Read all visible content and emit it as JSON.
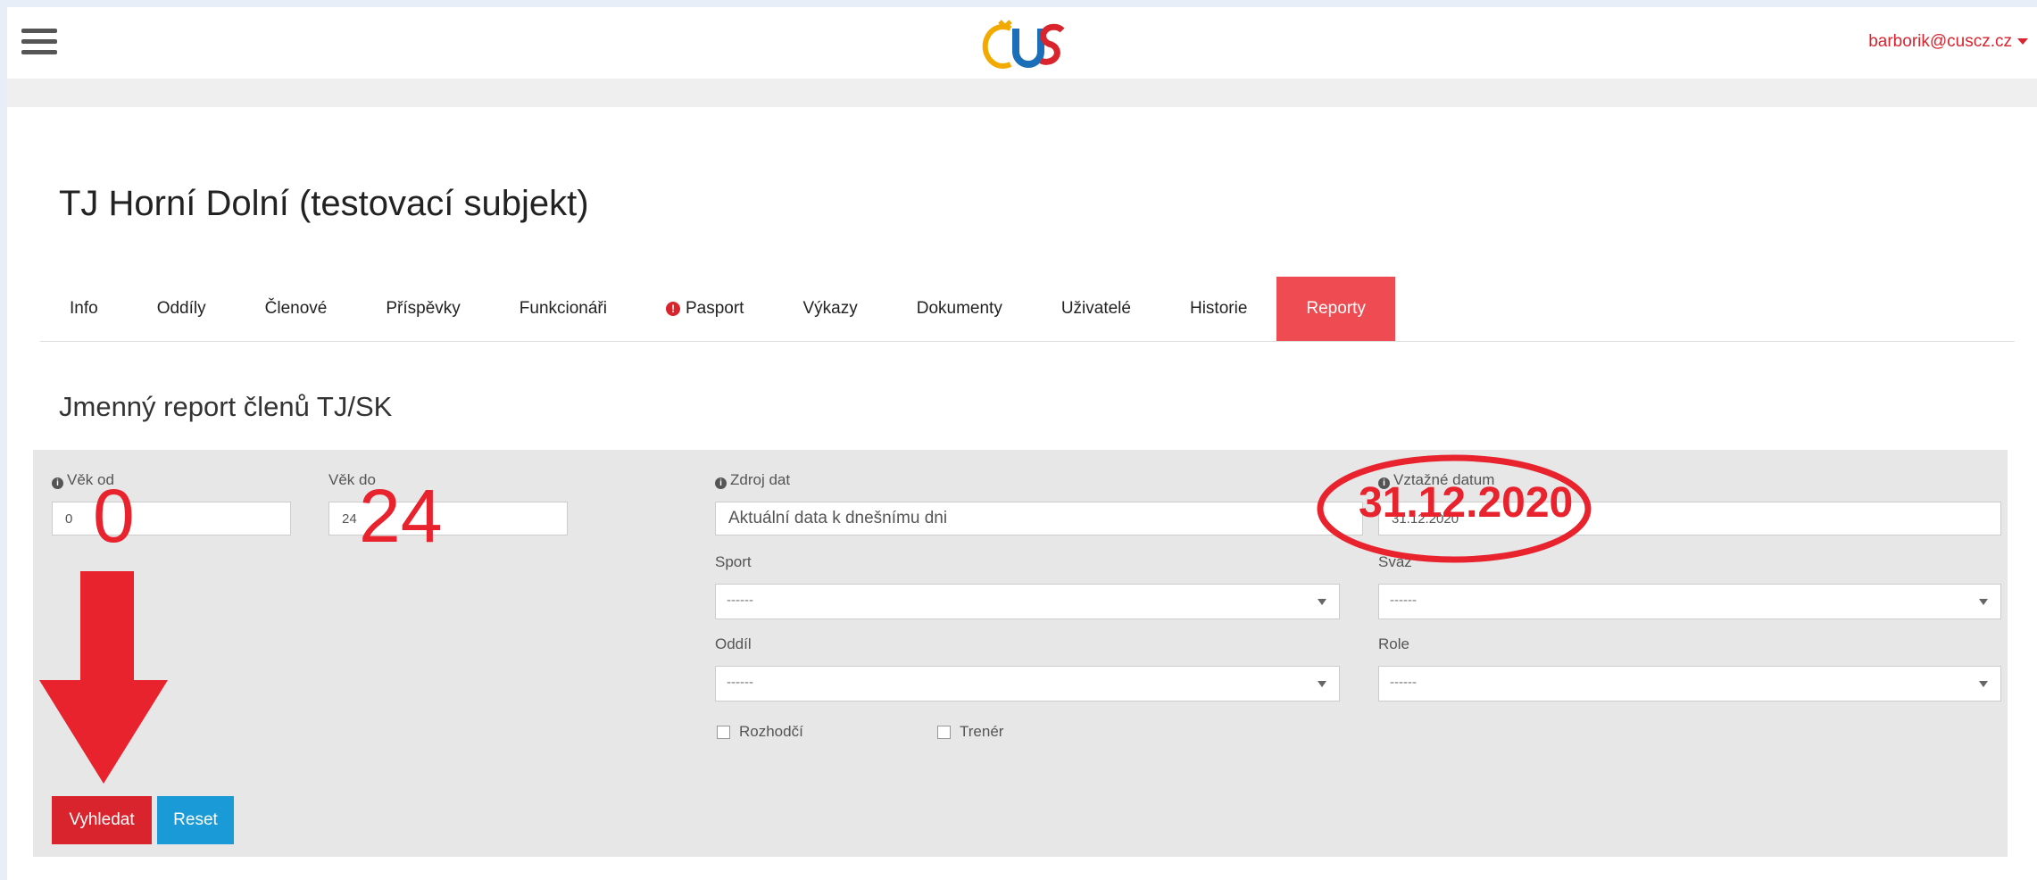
{
  "header": {
    "user_email": "barborik@cuscz.cz",
    "logo_icon": "cus-logo-icon",
    "menu_icon": "hamburger-icon"
  },
  "page": {
    "title": "TJ Horní Dolní (testovací subjekt)"
  },
  "tabs": [
    {
      "label": "Info",
      "active": false
    },
    {
      "label": "Oddíly",
      "active": false
    },
    {
      "label": "Členové",
      "active": false
    },
    {
      "label": "Příspěvky",
      "active": false
    },
    {
      "label": "Funkcionáři",
      "active": false
    },
    {
      "label": "Pasport",
      "active": false,
      "icon": "warning-icon"
    },
    {
      "label": "Výkazy",
      "active": false
    },
    {
      "label": "Dokumenty",
      "active": false
    },
    {
      "label": "Uživatelé",
      "active": false
    },
    {
      "label": "Historie",
      "active": false
    },
    {
      "label": "Reporty",
      "active": true
    }
  ],
  "report": {
    "title": "Jmenný report členů TJ/SK",
    "age_from": {
      "label": "Věk od",
      "value": "0"
    },
    "age_to": {
      "label": "Věk do",
      "value": "24"
    },
    "data_source": {
      "label": "Zdroj dat",
      "value": "Aktuální data k dnešnímu dni"
    },
    "reference_date": {
      "label": "Vztažné datum",
      "value": "31.12.2020"
    },
    "sport": {
      "label": "Sport",
      "value": "------"
    },
    "union": {
      "label": "Svaz",
      "value": "------"
    },
    "division": {
      "label": "Oddíl",
      "value": "------"
    },
    "role": {
      "label": "Role",
      "value": "------"
    },
    "referee": {
      "label": "Rozhodčí",
      "checked": false
    },
    "coach": {
      "label": "Trenér",
      "checked": false
    },
    "search_label": "Vyhledat",
    "reset_label": "Reset"
  },
  "annotations": {
    "age_from": "0",
    "age_to": "24",
    "date": "31.12.2020",
    "color": "#e8232e"
  },
  "colors": {
    "accent": "#ef4b52",
    "primary_button": "#d9232d",
    "info_button": "#1a9ad6"
  }
}
